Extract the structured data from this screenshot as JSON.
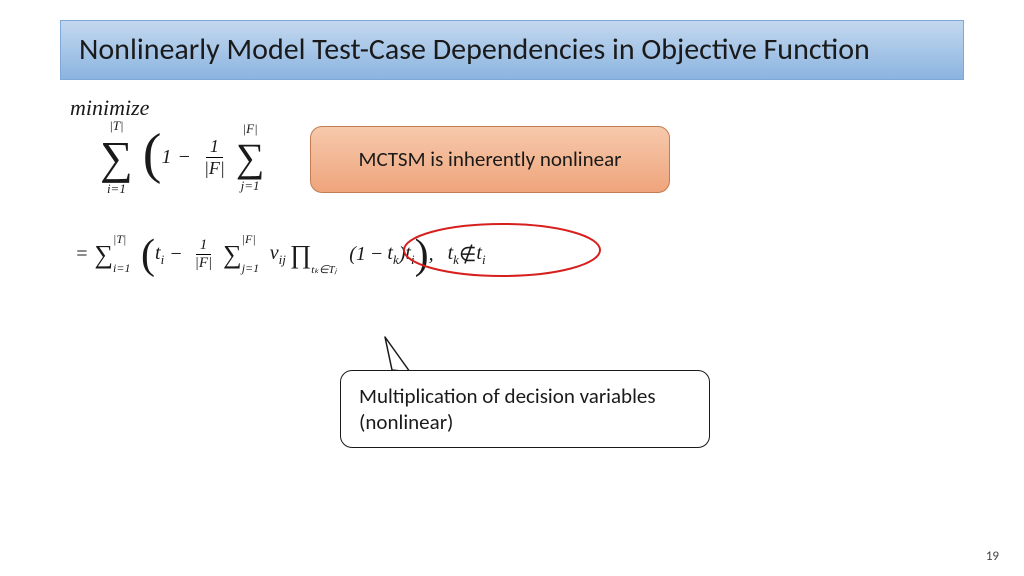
{
  "title": "Nonlinearly Model Test-Case Dependencies in Objective Function",
  "minimize": "minimize",
  "callout_orange": "MCTSM is inherently nonlinear",
  "callout_white": "Multiplication of decision variables (nonlinear)",
  "page_number": "19",
  "eq1": {
    "sum_upper": "|T|",
    "sum_lower": "i=1",
    "one": "1",
    "frac_num": "1",
    "frac_den": "|F|",
    "inner_sum_upper": "|F|",
    "inner_sum_lower": "j=1"
  },
  "eq2": {
    "eq": "=",
    "sum_upper": "|T|",
    "sum_lower": "i=1",
    "ti": "t",
    "ti_sub": "i",
    "frac_num": "1",
    "frac_den": "|F|",
    "isum_upper": "|F|",
    "isum_lower": "j=1",
    "vij": "v",
    "vij_sub": "ij",
    "prod_sub": "tₖ∈Tⱼ",
    "one": "1",
    "tk": "t",
    "tk_sub": "k",
    "ti2": "t",
    "ti2_sub": "i",
    "cond_tk": "t",
    "cond_tk_sub": "k",
    "notin": " ∉ ",
    "cond_ti": "t",
    "cond_ti_sub": "i"
  }
}
